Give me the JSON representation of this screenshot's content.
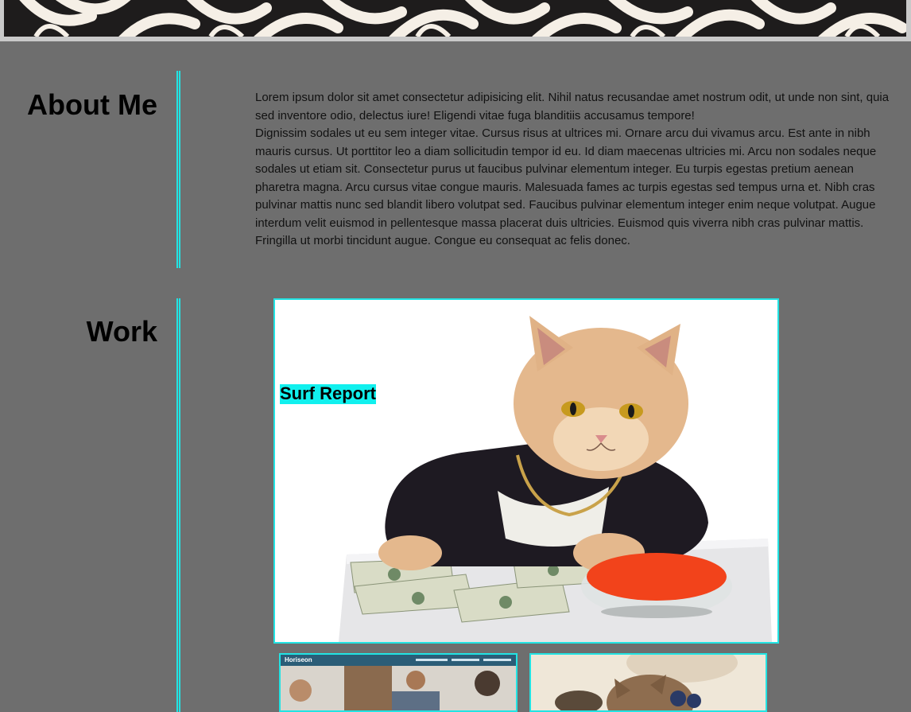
{
  "about": {
    "title": "About Me",
    "paragraphs": [
      "Lorem ipsum dolor sit amet consectetur adipisicing elit. Nihil natus recusandae amet nostrum odit, ut unde non sint, quia sed inventore odio, delectus iure! Eligendi vitae fuga blanditiis accusamus tempore!",
      "Dignissim sodales ut eu sem integer vitae. Cursus risus at ultrices mi. Ornare arcu dui vivamus arcu. Est ante in nibh mauris cursus. Ut porttitor leo a diam sollicitudin tempor id eu. Id diam maecenas ultricies mi. Arcu non sodales neque sodales ut etiam sit. Consectetur purus ut faucibus pulvinar elementum integer. Eu turpis egestas pretium aenean pharetra magna. Arcu cursus vitae congue mauris. Malesuada fames ac turpis egestas sed tempus urna et. Nibh cras pulvinar mattis nunc sed blandit libero volutpat sed. Faucibus pulvinar elementum integer enim neque volutpat. Augue interdum velit euismod in pellentesque massa placerat duis ultricies. Euismod quis viverra nibh cras pulvinar mattis. Fringilla ut morbi tincidunt augue. Congue eu consequat ac felis donec."
    ]
  },
  "work": {
    "title": "Work",
    "featured": {
      "label": "Surf Report",
      "image": "cat-with-money-photo"
    },
    "thumbnails": [
      {
        "image": "horiseon-website-screenshot",
        "brand": "Horiseon"
      },
      {
        "image": "cat-with-sunglasses-photo"
      }
    ]
  },
  "colors": {
    "accent": "#22e3e3",
    "label_bg": "#11f0ee",
    "background": "#6e6e6e"
  }
}
